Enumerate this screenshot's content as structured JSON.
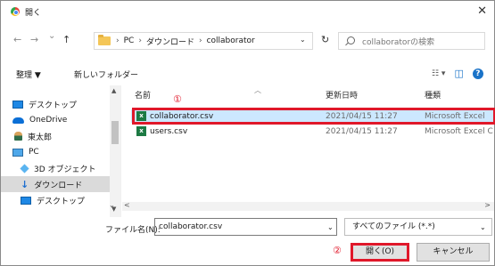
{
  "window": {
    "title": "開く",
    "close": "✕"
  },
  "nav": {
    "back": "←",
    "forward": "→",
    "dropdown": "⌄",
    "up": "↑",
    "breadcrumb": [
      "PC",
      "ダウンロード",
      "collaborator"
    ],
    "crumb_lead_sep": "›",
    "addr_chevron": "⌄",
    "refresh": "↻",
    "search_placeholder": "collaboratorの検索"
  },
  "toolbar": {
    "organize": "整理 ▼",
    "new_folder": "新しいフォルダー",
    "view": "☷ ▾",
    "pane": "◫",
    "help": "?"
  },
  "sidebar": {
    "items": [
      {
        "label": "デスクトップ",
        "icon": "desktop-icon"
      },
      {
        "label": "OneDrive",
        "icon": "cloud-icon"
      },
      {
        "label": "東太郎",
        "icon": "user-icon"
      },
      {
        "label": "PC",
        "icon": "pc-icon"
      },
      {
        "label": "3D オブジェクト",
        "icon": "cube-icon"
      },
      {
        "label": "ダウンロード",
        "icon": "download-icon"
      },
      {
        "label": "デスクトップ",
        "icon": "desktop-icon"
      }
    ]
  },
  "columns": {
    "name": "名前",
    "modified": "更新日時",
    "type": "種類"
  },
  "files": [
    {
      "name": "collaborator.csv",
      "modified": "2021/04/15 11:27",
      "type": "Microsoft Excel"
    },
    {
      "name": "users.csv",
      "modified": "2021/04/15 11:27",
      "type": "Microsoft Excel C"
    }
  ],
  "annotations": {
    "one": "①",
    "two": "②"
  },
  "footer": {
    "filename_label": "ファイル名(N):",
    "filename_value": "collaborator.csv",
    "filetype": "すべてのファイル (*.*)",
    "open": "開く(O)",
    "cancel": "キャンセル"
  },
  "colors": {
    "highlight": "#e0182a",
    "selected_row": "#cce8ff",
    "excel": "#1d7a44"
  }
}
